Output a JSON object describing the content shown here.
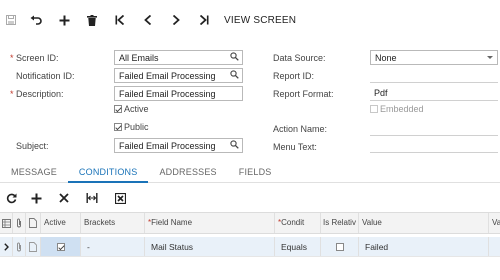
{
  "toolbar": {
    "view_screen_label": "VIEW SCREEN"
  },
  "form": {
    "screen_id": {
      "label": "Screen ID:",
      "value": "All Emails"
    },
    "notification_id": {
      "label": "Notification ID:",
      "value": "Failed Email Processing"
    },
    "description": {
      "label": "Description:",
      "value": "Failed Email Processing"
    },
    "active_label": "Active",
    "active_checked": true,
    "public_label": "Public",
    "public_checked": true,
    "subject": {
      "label": "Subject:",
      "value": "Failed Email Processing"
    },
    "data_source": {
      "label": "Data Source:",
      "value": "None"
    },
    "report_id": {
      "label": "Report ID:",
      "value": ""
    },
    "report_format": {
      "label": "Report Format:",
      "value": "Pdf"
    },
    "embedded_label": "Embedded",
    "embedded_checked": false,
    "action_name": {
      "label": "Action Name:",
      "value": ""
    },
    "menu_text": {
      "label": "Menu Text:",
      "value": ""
    }
  },
  "tabs": [
    {
      "label": "MESSAGE",
      "active": false
    },
    {
      "label": "CONDITIONS",
      "active": true
    },
    {
      "label": "ADDRESSES",
      "active": false
    },
    {
      "label": "FIELDS",
      "active": false
    }
  ],
  "grid": {
    "columns": {
      "active": "Active",
      "brackets": "Brackets",
      "field_name": "Field Name",
      "condition": "Condit",
      "is_relative": "Is Relativ",
      "value": "Value",
      "value2": "Va"
    },
    "rows": [
      {
        "active": true,
        "brackets": "-",
        "field_name": "Mail Status",
        "condition": "Equals",
        "is_relative": false,
        "value": "Failed"
      }
    ]
  },
  "colors": {
    "accent": "#1a73b8",
    "required": "#c0392b",
    "row_highlight": "#e9f1f9"
  }
}
